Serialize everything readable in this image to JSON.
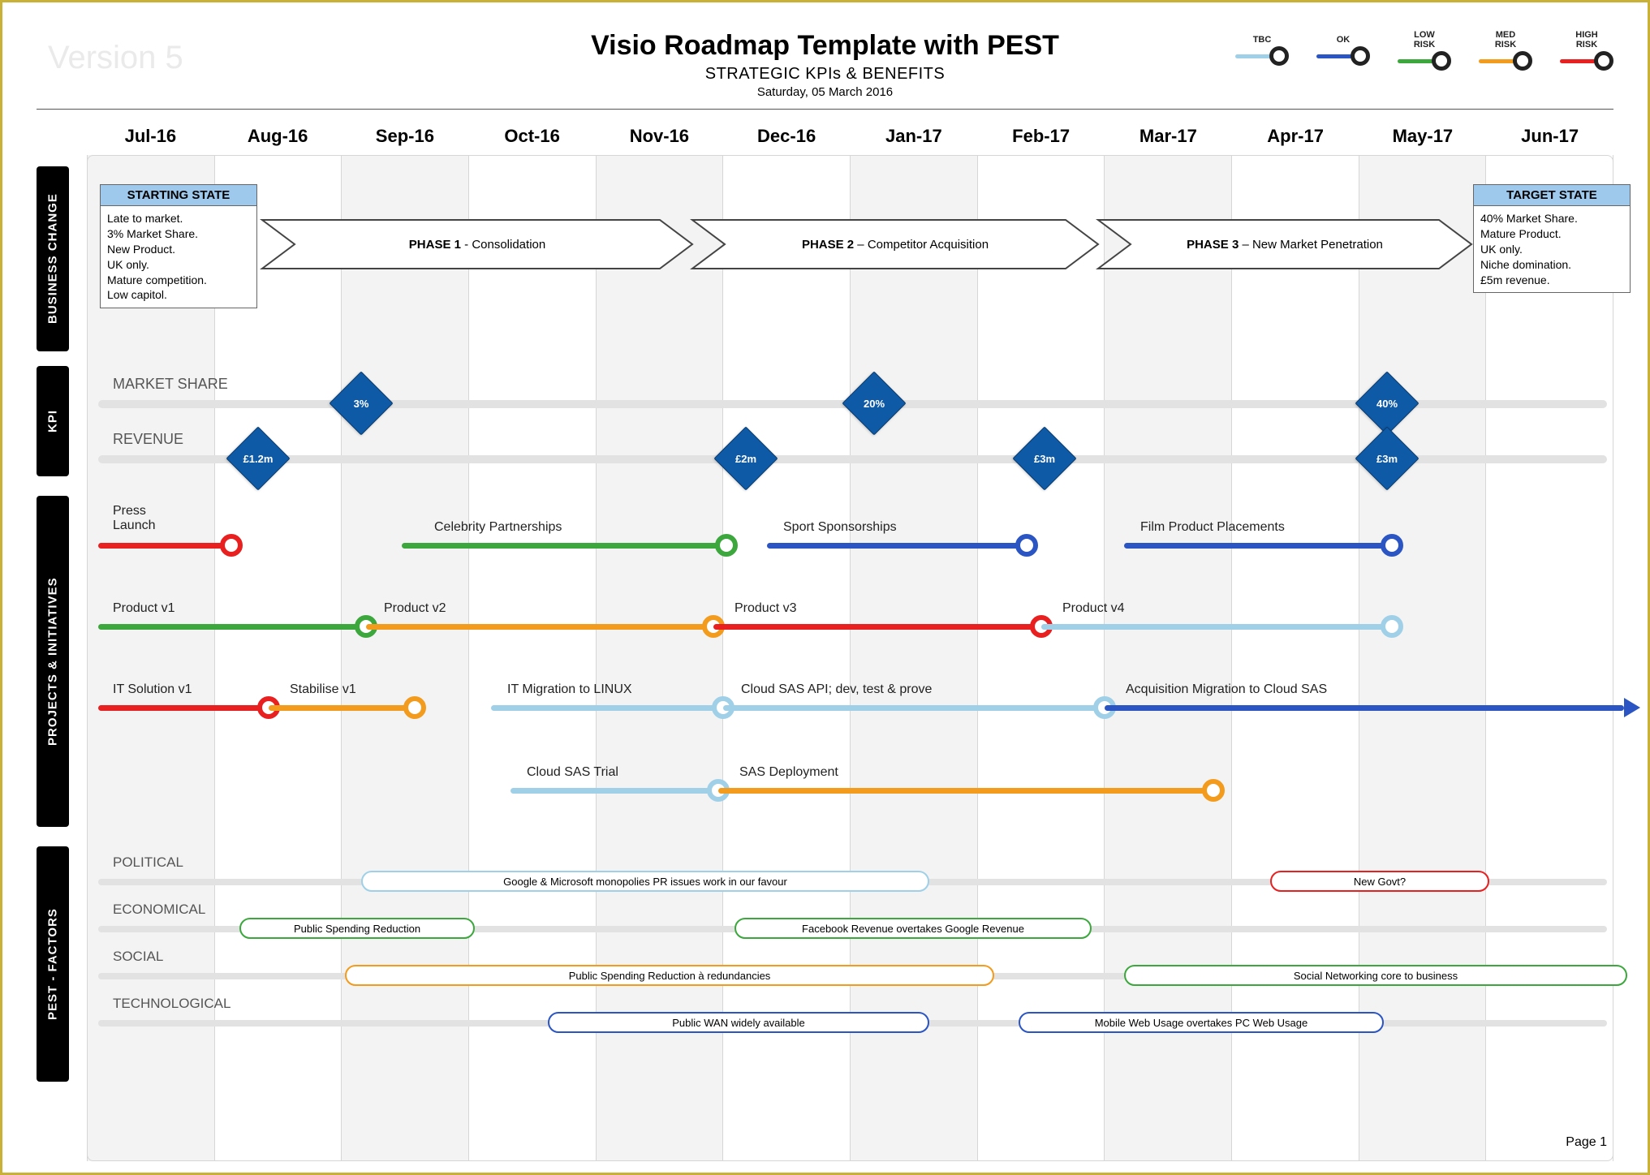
{
  "version": "Version 5",
  "title": "Visio Roadmap Template with PEST",
  "subtitle": "STRATEGIC KPIs & BENEFITS",
  "date": "Saturday, 05 March 2016",
  "page_num": "Page 1",
  "colors": {
    "tbc": "#9fd0e8",
    "ok": "#2b55c3",
    "low": "#3ca73c",
    "med": "#f29b1d",
    "high": "#e82020"
  },
  "legend": [
    {
      "label": "TBC",
      "color": "tbc"
    },
    {
      "label": "OK",
      "color": "ok"
    },
    {
      "label": "LOW\nRISK",
      "color": "low"
    },
    {
      "label": "MED\nRISK",
      "color": "med"
    },
    {
      "label": "HIGH\nRISK",
      "color": "high"
    }
  ],
  "months": [
    "Jul-16",
    "Aug-16",
    "Sep-16",
    "Oct-16",
    "Nov-16",
    "Dec-16",
    "Jan-17",
    "Feb-17",
    "Mar-17",
    "Apr-17",
    "May-17",
    "Jun-17"
  ],
  "sections": {
    "business_change": "BUSINESS CHANGE",
    "kpi": "KPI",
    "projects": "PROJECTS & INITIATIVES",
    "pest": "PEST - FACTORS"
  },
  "starting_state": {
    "header": "STARTING STATE",
    "body": "Late to market.\n3% Market Share.\nNew Product.\nUK only.\nMature competition.\nLow capitol."
  },
  "target_state": {
    "header": "TARGET STATE",
    "body": "40% Market Share.\nMature Product.\nUK only.\nNiche domination.\n£5m revenue."
  },
  "phases": [
    {
      "name": "PHASE 1",
      "detail": " - Consolidation"
    },
    {
      "name": "PHASE 2",
      "detail": " – Competitor Acquisition"
    },
    {
      "name": "PHASE 3",
      "detail": " – New Market Penetration"
    }
  ],
  "kpi_rows": [
    {
      "label": "MARKET SHARE",
      "milestones": [
        {
          "month": "Sep-16",
          "value": "3%"
        },
        {
          "month": "Jan-17",
          "value": "20%"
        },
        {
          "month": "May-17",
          "value": "40%"
        }
      ]
    },
    {
      "label": "REVENUE",
      "milestones": [
        {
          "month": "Aug-16",
          "value": "£1.2m"
        },
        {
          "month": "Dec-16",
          "value": "£2m"
        },
        {
          "month": "Feb-17",
          "value": "£3m"
        },
        {
          "month": "May-17",
          "value": "£3m"
        }
      ]
    }
  ],
  "initiative_rows": [
    {
      "items": [
        {
          "label": "Press Launch",
          "start": "Jul-16",
          "end": "Aug-16",
          "color": "high"
        },
        {
          "label": "Celebrity Partnerships",
          "start": "Sep-16",
          "end": "Dec-16",
          "color": "low"
        },
        {
          "label": "Sport Sponsorships",
          "start": "Dec-16",
          "end": "Feb-17",
          "color": "ok"
        },
        {
          "label": "Film Product Placements",
          "start": "Mar-17",
          "end": "May-17",
          "color": "ok"
        }
      ]
    },
    {
      "items": [
        {
          "label": "Product v1",
          "start": "Jul-16",
          "end": "Sep-16",
          "color": "low"
        },
        {
          "label": "Product v2",
          "start": "Sep-16",
          "end": "Dec-16",
          "color": "med"
        },
        {
          "label": "Product v3",
          "start": "Dec-16",
          "end": "Feb-17",
          "color": "high"
        },
        {
          "label": "Product v4",
          "start": "Feb-17",
          "end": "May-17",
          "color": "tbc"
        }
      ]
    },
    {
      "items": [
        {
          "label": "IT Solution v1",
          "start": "Jul-16",
          "end": "Aug-16",
          "color": "high"
        },
        {
          "label": "Stabilise v1",
          "start": "Aug-16",
          "end": "Sep-16",
          "color": "med"
        },
        {
          "label": "IT Migration to LINUX",
          "start": "Oct-16",
          "end": "Dec-16",
          "color": "tbc"
        },
        {
          "label": "Cloud SAS API; dev, test & prove",
          "start": "Dec-16",
          "end": "Mar-17",
          "color": "tbc"
        },
        {
          "label": "Acquisition Migration to Cloud SAS",
          "start": "Mar-17",
          "end": "Jun-17",
          "color": "ok",
          "arrow_end": true
        }
      ]
    },
    {
      "items": [
        {
          "label": "Cloud SAS Trial",
          "start": "Oct-16",
          "end": "Dec-16",
          "color": "tbc"
        },
        {
          "label": "SAS Deployment",
          "start": "Dec-16",
          "end": "Apr-17",
          "color": "med"
        }
      ]
    }
  ],
  "pest_categories": [
    "POLITICAL",
    "ECONOMICAL",
    "SOCIAL",
    "TECHNOLOGICAL"
  ],
  "pest_items": [
    {
      "row": 0,
      "label": "Google & Microsoft monopolies PR issues work in our favour",
      "start": "Sep-16",
      "end": "Feb-17",
      "color": "tbc"
    },
    {
      "row": 0,
      "label": "New Govt?",
      "start": "Apr-17",
      "end": "Jun-17",
      "color": "high"
    },
    {
      "row": 1,
      "label": "Public Spending Reduction",
      "start": "Aug-16",
      "end": "Oct-16",
      "color": "low"
    },
    {
      "row": 1,
      "label": "Facebook Revenue overtakes Google Revenue",
      "start": "Dec-16",
      "end": "Mar-17",
      "color": "low"
    },
    {
      "row": 2,
      "label": "Public Spending Reduction à redundancies",
      "start": "Sep-16",
      "end": "Feb-17",
      "color": "med"
    },
    {
      "row": 2,
      "label": "Social Networking core to business",
      "start": "Mar-17",
      "end": "Jul-17",
      "color": "low"
    },
    {
      "row": 3,
      "label": "Public WAN widely available",
      "start": "Oct-16",
      "end": "Feb-17",
      "color": "ok"
    },
    {
      "row": 3,
      "label": "Mobile Web Usage overtakes PC Web Usage",
      "start": "Feb-17",
      "end": "May-17",
      "color": "ok"
    }
  ],
  "chart_data": {
    "type": "gantt-roadmap",
    "x_axis": [
      "Jul-16",
      "Aug-16",
      "Sep-16",
      "Oct-16",
      "Nov-16",
      "Dec-16",
      "Jan-17",
      "Feb-17",
      "Mar-17",
      "Apr-17",
      "May-17",
      "Jun-17"
    ],
    "sections": [
      "BUSINESS CHANGE",
      "KPI",
      "PROJECTS & INITIATIVES",
      "PEST - FACTORS"
    ],
    "phases": [
      {
        "name": "PHASE 1 - Consolidation",
        "span": [
          "Aug-16",
          "Nov-16"
        ]
      },
      {
        "name": "PHASE 2 – Competitor Acquisition",
        "span": [
          "Nov-16",
          "Mar-17"
        ]
      },
      {
        "name": "PHASE 3 – New Market Penetration",
        "span": [
          "Mar-17",
          "May-17"
        ]
      }
    ],
    "kpis": [
      {
        "name": "MARKET SHARE",
        "points": [
          {
            "x": "Sep-16",
            "y": "3%"
          },
          {
            "x": "Jan-17",
            "y": "20%"
          },
          {
            "x": "May-17",
            "y": "40%"
          }
        ]
      },
      {
        "name": "REVENUE",
        "points": [
          {
            "x": "Aug-16",
            "y": "£1.2m"
          },
          {
            "x": "Dec-16",
            "y": "£2m"
          },
          {
            "x": "Feb-17",
            "y": "£3m"
          },
          {
            "x": "May-17",
            "y": "£3m"
          }
        ]
      }
    ],
    "color_legend": {
      "TBC": "#9fd0e8",
      "OK": "#2b55c3",
      "LOW RISK": "#3ca73c",
      "MED RISK": "#f29b1d",
      "HIGH RISK": "#e82020"
    }
  }
}
